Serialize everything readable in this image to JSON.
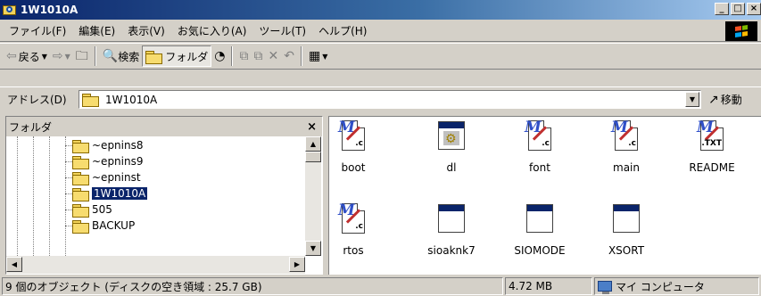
{
  "window": {
    "title": "1W1010A",
    "minimize_glyph": "_",
    "maximize_glyph": "□",
    "close_glyph": "×"
  },
  "menu": {
    "items": [
      "ファイル(F)",
      "編集(E)",
      "表示(V)",
      "お気に入り(A)",
      "ツール(T)",
      "ヘルプ(H)"
    ]
  },
  "toolbar": {
    "back_label": "戻る",
    "search_label": "検索",
    "folders_label": "フォルダ"
  },
  "address": {
    "label": "アドレス(D)",
    "value": "1W1010A",
    "go_label": "移動"
  },
  "folder_pane": {
    "title": "フォルダ",
    "close_glyph": "×",
    "tree": [
      "~epnins8",
      "~epnins9",
      "~epninst",
      "1W1010A",
      "505",
      "BACKUP"
    ],
    "selected": "1W1010A"
  },
  "files": [
    {
      "name": "boot",
      "icon": "c-source-icon",
      "ext": ".c"
    },
    {
      "name": "dl",
      "icon": "executable-icon",
      "ext": ""
    },
    {
      "name": "font",
      "icon": "c-source-icon",
      "ext": ".c"
    },
    {
      "name": "main",
      "icon": "c-source-icon",
      "ext": ".c"
    },
    {
      "name": "README",
      "icon": "text-file-icon",
      "ext": ".TXT"
    },
    {
      "name": "rtos",
      "icon": "c-source-icon",
      "ext": ".c"
    },
    {
      "name": "sioaknk7",
      "icon": "application-window-icon",
      "ext": ""
    },
    {
      "name": "SIOMODE",
      "icon": "application-window-icon",
      "ext": ""
    },
    {
      "name": "XSORT",
      "icon": "application-window-icon",
      "ext": ""
    }
  ],
  "status": {
    "objects": "9 個のオブジェクト (ディスクの空き領域 : 25.7 GB)",
    "size": "4.72 MB",
    "location": "マイ コンピュータ"
  },
  "colors": {
    "title_active": "#0a246a",
    "title_gradient_end": "#a6caf0",
    "selection": "#0a246a",
    "face": "#d4d0c8"
  }
}
